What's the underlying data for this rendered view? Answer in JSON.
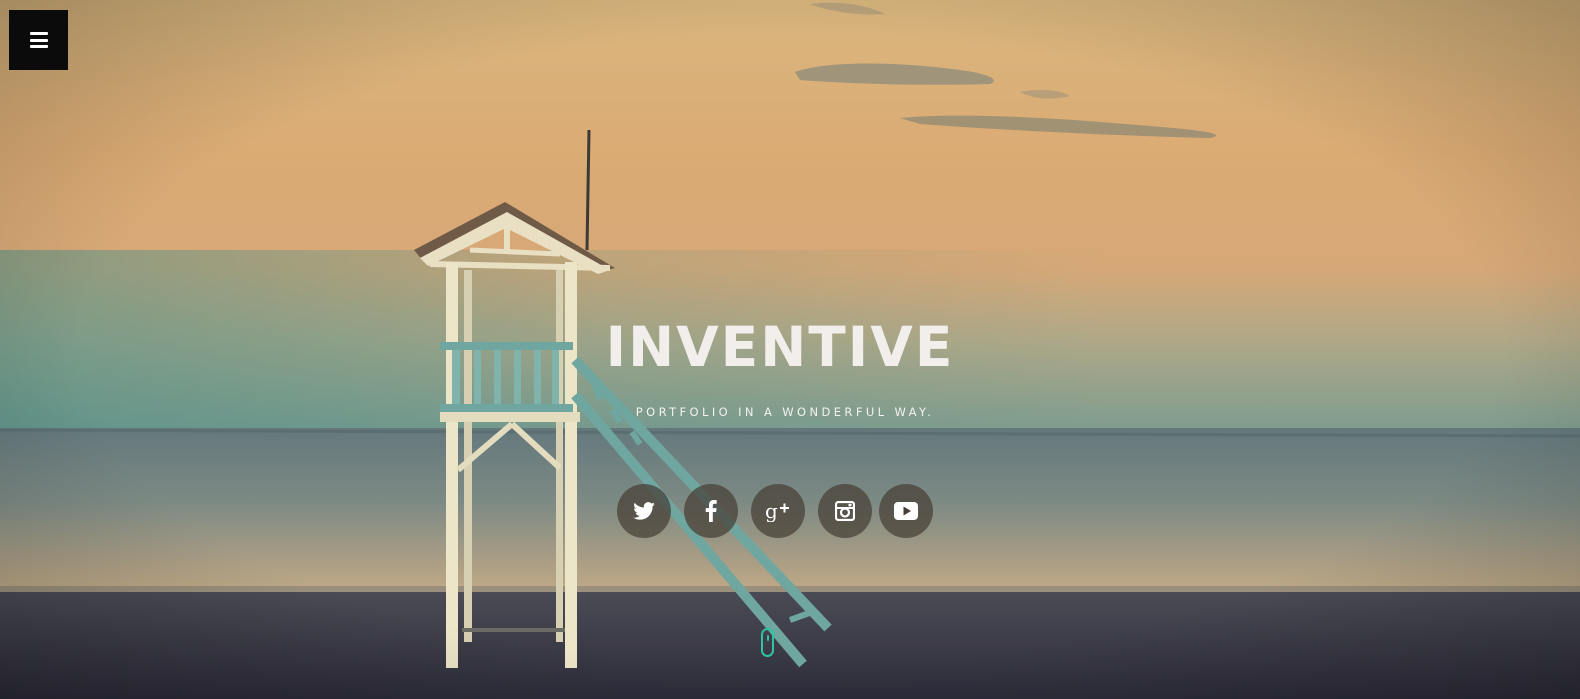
{
  "hero": {
    "title": "INVENTIVE",
    "subtitle": "PORTFOLIO IN A WONDERFUL WAY."
  },
  "menu": {
    "icon": "hamburger-menu-icon"
  },
  "social": [
    {
      "network": "twitter",
      "icon": "twitter-icon"
    },
    {
      "network": "facebook",
      "icon": "facebook-icon"
    },
    {
      "network": "google-plus",
      "icon": "google-plus-icon"
    },
    {
      "network": "instagram",
      "icon": "instagram-icon"
    },
    {
      "network": "youtube",
      "icon": "youtube-icon"
    }
  ],
  "scroll_indicator": {
    "icon": "mouse-scroll-icon"
  },
  "colors": {
    "accent": "#2ec3a3",
    "menu_background": "#0b0b0b",
    "social_circle": "#463e34"
  }
}
